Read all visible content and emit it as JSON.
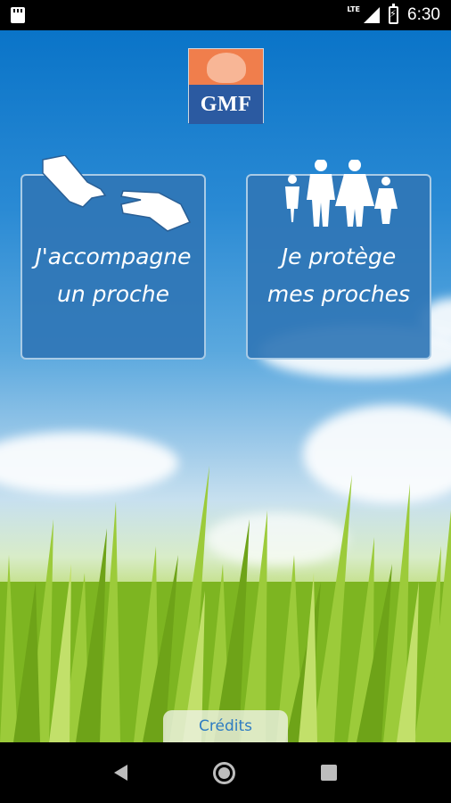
{
  "status_bar": {
    "time": "6:30",
    "network_label": "LTE",
    "icons": [
      "sd-card-icon",
      "signal-icon",
      "battery-charging-icon"
    ]
  },
  "logo": {
    "text": "GMF",
    "colors": {
      "top": "#f07e4c",
      "bottom": "#2b5aa1"
    }
  },
  "cards": [
    {
      "label": "J'accompagne\nun proche",
      "icon": "hands-icon"
    },
    {
      "label": "Je protège\nmes proches",
      "icon": "family-icon"
    }
  ],
  "credits": {
    "label": "Crédits"
  },
  "nav_bar": {
    "icons": [
      "back-icon",
      "home-icon",
      "recent-apps-icon"
    ]
  },
  "colors": {
    "card_bg": "#3076b6",
    "card_border": "#a9cbe6",
    "credits_text": "#2e7cc2"
  }
}
